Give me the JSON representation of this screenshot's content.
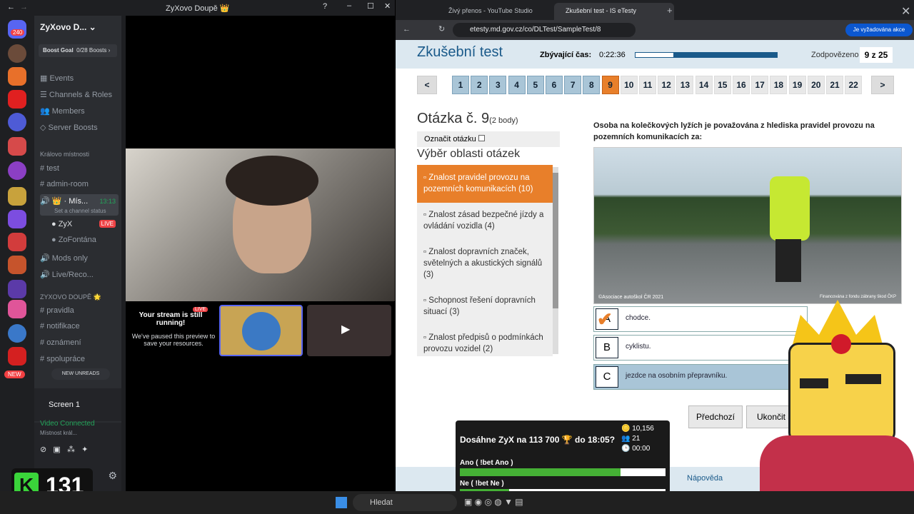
{
  "discord": {
    "window_title": "ZyXovo Doupě 👑",
    "server_name": "ZyXovo D...",
    "boost_goal": "Boost Goal",
    "boosts": "0/28 Boosts",
    "menu": [
      "Events",
      "Channels & Roles",
      "Members",
      "Server Boosts"
    ],
    "category1": "Králo­vo místnosti",
    "channels1": [
      "test",
      "admin-room"
    ],
    "voice_channel": "👑 · Mís...",
    "voice_time": "13:13",
    "voice_status": "Set a channel status",
    "voice_users": [
      {
        "name": "ZyX",
        "badge": "LIVE"
      },
      {
        "name": "ZoFontána"
      }
    ],
    "voice2": "Mods only",
    "voice3": "Live/Reco...",
    "category2": "ZYXOVO DOUPĚ 🌟",
    "channels2": [
      "pravidla",
      "notifikace",
      "oznámení",
      "spolupráce"
    ],
    "new_unreads": "NEW UNREADS",
    "rail_badges": [
      "240",
      "2",
      "2",
      "1",
      "3",
      "13",
      "NEW"
    ],
    "screen_label": "Screen 1",
    "video_connected": "Video Connected",
    "video_sub": "Místnost král...",
    "stream_title": "Your stream is still running!",
    "stream_live": "LIVE",
    "stream_msg": "We've paused this preview to save your resources.",
    "counter": "131"
  },
  "browser": {
    "tabs": [
      "Živý přenos - YouTube Studio",
      "Zkušební test - IS eTesty"
    ],
    "url": "etesty.md.gov.cz/co/DLTest/SampleTest/8",
    "action_pill": "Je vyžadována akce",
    "page_title": "Zkušební test",
    "time_label": "Zbývající čas:",
    "time_value": "0:22:36",
    "time_progress": 0.27,
    "answered_label": "Zodpovězeno",
    "answered_value": "9 z 25",
    "prev": "<",
    "next": ">",
    "questions": [
      "1",
      "2",
      "3",
      "4",
      "5",
      "6",
      "7",
      "8",
      "9",
      "10",
      "11",
      "12",
      "13",
      "14",
      "15",
      "16",
      "17",
      "18",
      "19",
      "20",
      "21",
      "22"
    ],
    "current_question": "9",
    "q_heading": "Otázka č. 9",
    "q_points": "(2 body)",
    "mark_label": "Označit otázku",
    "area_heading": "Výběr oblasti otázek",
    "categories": [
      "Znalost pravidel provozu na pozemních komunikacích (10)",
      "Znalost zásad bezpečné jízdy a ovládání vozidla (4)",
      "Znalost dopravních značek, světelných a akustických signálů (3)",
      "Schopnost řešení dopravních situací (3)",
      "Znalost předpisů o podmínkách provozu vozidel (2)"
    ],
    "question_text": "Osoba na kolečkových lyžích je považována z hlediska pravidel provozu na pozemních komunikacích za:",
    "photo_credit": "©Asociace autoškol ČR 2021",
    "photo_credit2": "Financována z fondu zábrany škod ČKP",
    "answers": [
      {
        "letter": "A",
        "text": "chodce."
      },
      {
        "letter": "B",
        "text": "cyklistu."
      },
      {
        "letter": "C",
        "text": "jezdce na osobním přepravníku."
      }
    ],
    "btn_prev": "Předchozí",
    "btn_end": "Ukončit a",
    "footer_link": "Nápověda"
  },
  "bet": {
    "title": "Dosáhne ZyX na 113 700 🏆 do 18:05?",
    "coins": "10,156",
    "users": "21",
    "timer": "00:00",
    "option1": "Ano ( !bet Ano )",
    "option1_frac": 0.78,
    "option2": "Ne ( !bet Ne )",
    "option2_frac": 0.24
  },
  "taskbar": {
    "search": "Hledat"
  }
}
